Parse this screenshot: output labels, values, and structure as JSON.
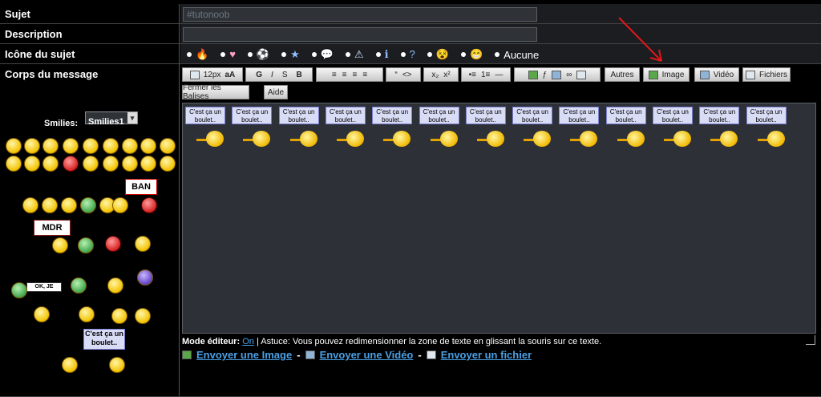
{
  "rows": {
    "subject": {
      "label": "Sujet",
      "value": "#tutonoob"
    },
    "description": {
      "label": "Description",
      "value": ""
    },
    "topic_icon": {
      "label": "Icône du sujet",
      "none_label": "Aucune",
      "icons": [
        "flame-icon",
        "heart-icon",
        "soccer-ball-icon",
        "star-icon",
        "speech-bubble-icon",
        "warning-icon",
        "info-icon",
        "question-icon",
        "emoji-dizzy-icon",
        "emoji-grin-icon"
      ]
    },
    "body": {
      "label": "Corps du message"
    }
  },
  "toolbar": {
    "font_size": "12px",
    "bold": "G",
    "italic": "I",
    "strike": "S",
    "bold2": "B",
    "autres": "Autres",
    "image": "Image",
    "video": "Vidéo",
    "fichiers": "Fichiers",
    "close_tags": "Fermer les Balises",
    "help": "Aide"
  },
  "smilies": {
    "label": "Smilies:",
    "selected": "Smilies1",
    "sign_ban": "BAN",
    "sign_mdr": "MDR",
    "sign_ok": "OK, JE SORS!",
    "bubble": "C'est ça un boulet.."
  },
  "editor": {
    "bubble_text": "C'est ça un boulet..",
    "count": 13
  },
  "footer": {
    "mode_label": "Mode éditeur:",
    "mode_value": "On",
    "tip": "| Astuce: Vous pouvez redimensionner la zone de texte en glissant la souris sur ce texte.",
    "send_image": "Envoyer une Image",
    "send_video": "Envoyer une Vidéo",
    "send_file": "Envoyer un fichier"
  },
  "colors": {
    "link": "#4aa0e6",
    "annotation_arrow": "#e01818"
  }
}
